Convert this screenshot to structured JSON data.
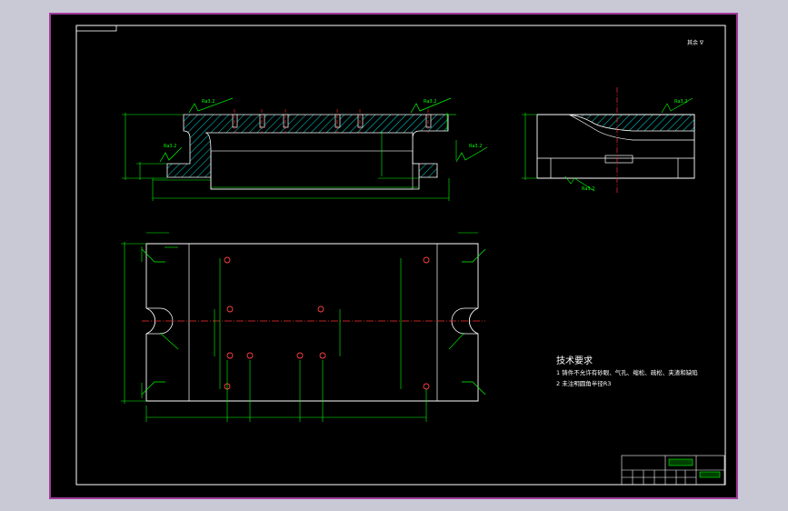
{
  "drawing": {
    "corner_note": "其余 ∇",
    "surface_marks": [
      "Ra3.2",
      "Ra3.2",
      "Ra3.2",
      "Ra3.2",
      "Ra3.2",
      "Ra3.2"
    ],
    "tech_requirements": {
      "title": "技术要求",
      "items": [
        "1 铸件不允许有砂眼、气孔、缩松、疏松、夹渣和缺陷",
        "2 未注明圆角半径R3"
      ]
    },
    "colors": {
      "outline": "#ffffff",
      "dimension": "#00ff00",
      "hatch": "#00ffff",
      "centerline": "#ff3030",
      "text": "#ffffff",
      "frame": "#ffffff",
      "window_border": "#a03c9b"
    }
  }
}
